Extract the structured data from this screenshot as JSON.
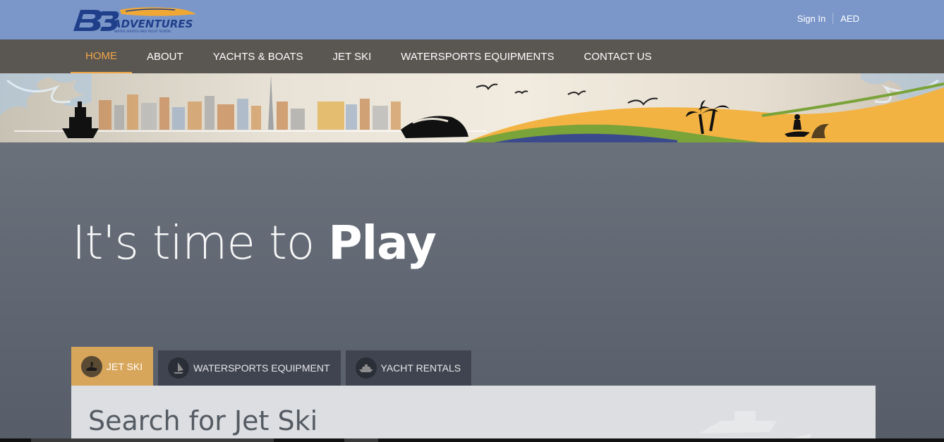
{
  "header": {
    "logo_text": "ADVENTURES",
    "logo_tagline": "WATER SPORTS AND YACHT RENTAL",
    "sign_in": "Sign In",
    "currency": "AED"
  },
  "nav": {
    "items": [
      {
        "label": "HOME",
        "active": true
      },
      {
        "label": "ABOUT",
        "active": false
      },
      {
        "label": "YACHTS & BOATS",
        "active": false
      },
      {
        "label": "JET SKI",
        "active": false
      },
      {
        "label": "WATERSPORTS EQUIPMENTS",
        "active": false
      },
      {
        "label": "CONTACT US",
        "active": false
      }
    ]
  },
  "hero": {
    "headline_light": "It's time to ",
    "headline_bold": "Play"
  },
  "tabs": [
    {
      "label": "JET SKI",
      "icon": "jet-ski-icon",
      "active": true
    },
    {
      "label": "WATERSPORTS EQUIPMENT",
      "icon": "windsurf-icon",
      "active": false
    },
    {
      "label": "YACHT RENTALS",
      "icon": "yacht-icon",
      "active": false
    }
  ],
  "search": {
    "title": "Search for Jet Ski"
  },
  "colors": {
    "topbar": "#7b97c9",
    "nav": "#5a5652",
    "accent": "#f0a546",
    "active_tab": "#d7a65a"
  }
}
